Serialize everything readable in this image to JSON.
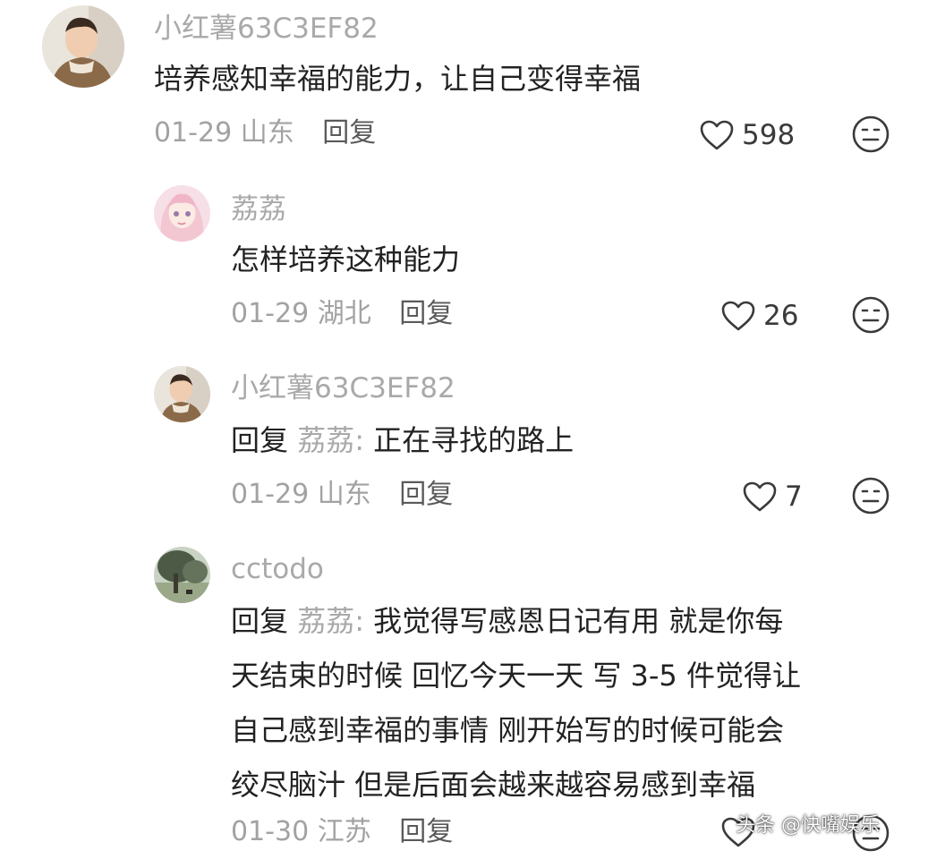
{
  "comments": [
    {
      "username": "小红薯63C3EF82",
      "text": "培养感知幸福的能力，让自己变得幸福",
      "date": "01-29",
      "location": "山东",
      "reply_label": "回复",
      "likes": "598",
      "avatar_icon": "boy-photo-avatar"
    },
    {
      "username": "荔荔",
      "text": "怎样培养这种能力",
      "date": "01-29",
      "location": "湖北",
      "reply_label": "回复",
      "likes": "26",
      "avatar_icon": "anime-girl-avatar"
    },
    {
      "username": "小红薯63C3EF82",
      "reply_prefix": "回复",
      "reply_to": "荔荔:",
      "text": "正在寻找的路上",
      "date": "01-29",
      "location": "山东",
      "reply_label": "回复",
      "likes": "7",
      "avatar_icon": "boy-photo-avatar"
    },
    {
      "username": "cctodo",
      "reply_prefix": "回复",
      "reply_to": "荔荔:",
      "lines": [
        "我觉得写感恩日记有用 就是你每",
        "天结束的时候 回忆今天一天 写 3-5 件觉得让",
        "自己感到幸福的事情 刚开始写的时候可能会",
        "绞尽脑汁 但是后面会越来越容易感到幸福"
      ],
      "date": "01-30",
      "location": "江苏",
      "reply_label": "回复",
      "avatar_icon": "tree-landscape-avatar"
    }
  ],
  "watermark": "头条 @快嘴娱乐",
  "colors": {
    "username": "#a9a9a9",
    "text": "#222222",
    "meta": "#a2a2a2",
    "icon": "#3a3a3a"
  }
}
